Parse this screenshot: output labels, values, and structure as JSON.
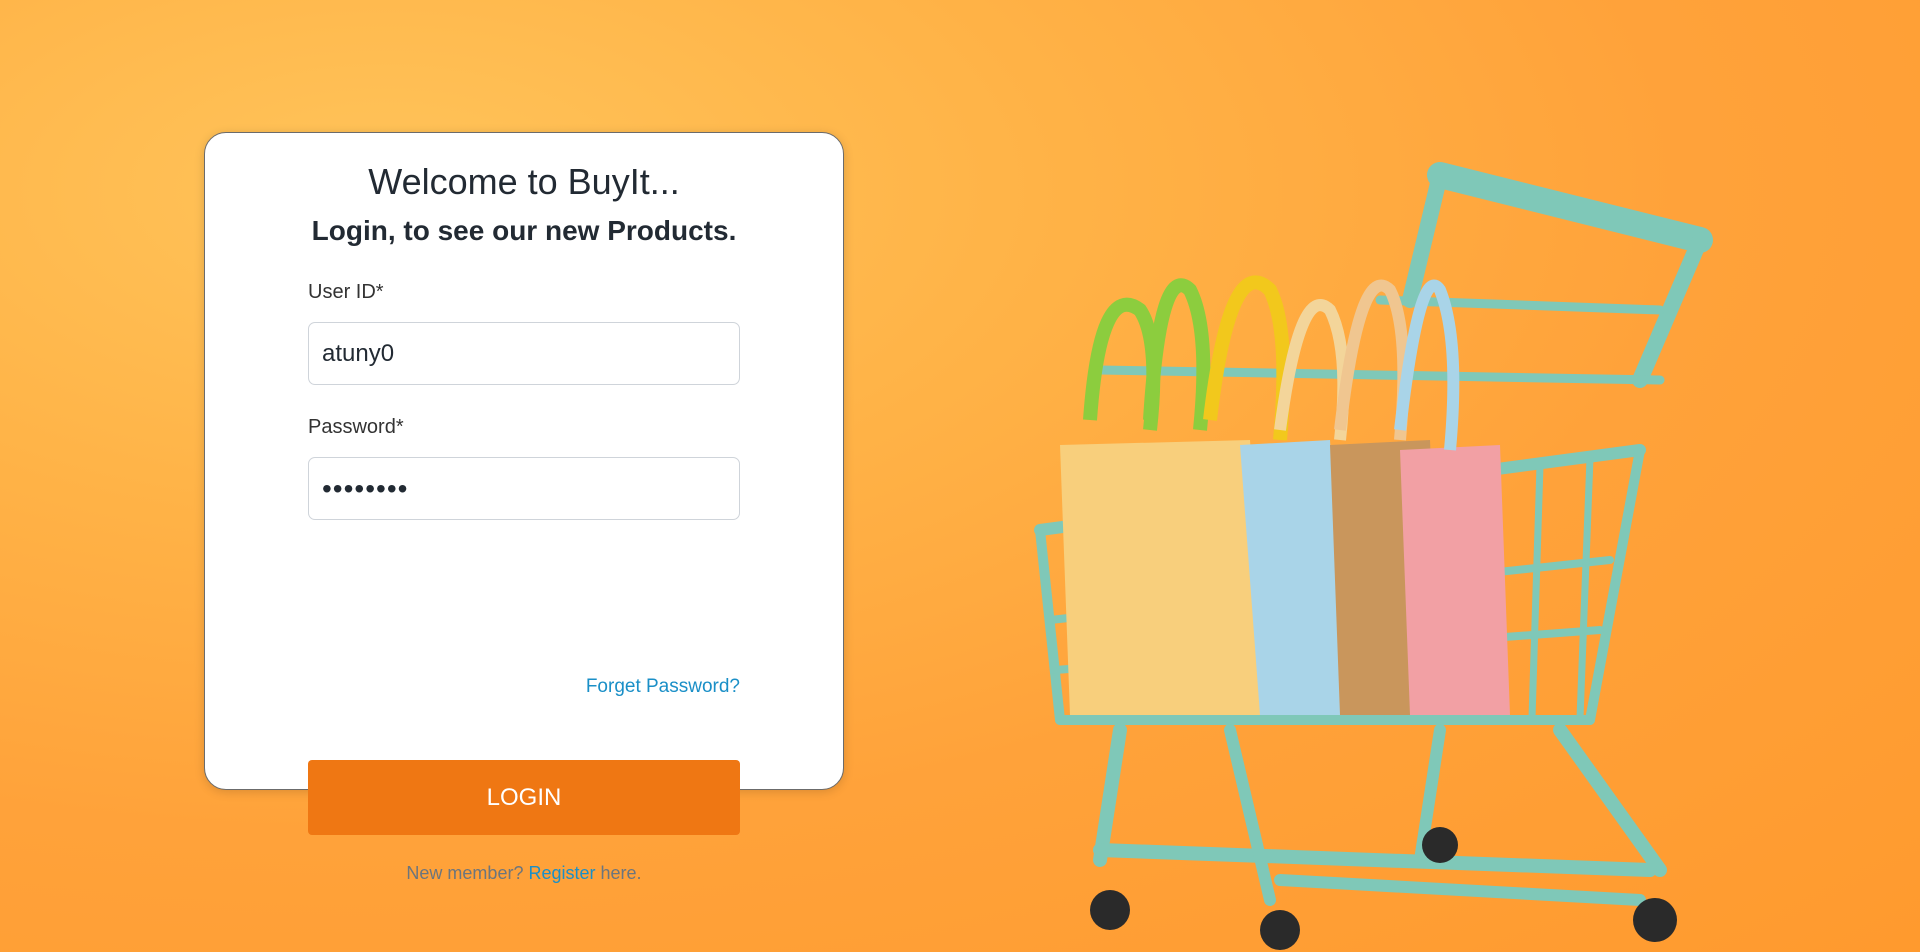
{
  "login_card": {
    "title": "Welcome to BuyIt...",
    "subtitle": "Login, to see our new Products.",
    "user_id": {
      "label": "User ID*",
      "value": "atuny0"
    },
    "password": {
      "label": "Password*",
      "value": "••••••••"
    },
    "forgot_password_label": "Forget Password?",
    "login_button_label": "LOGIN",
    "register": {
      "prefix": "New member?",
      "link_label": "Register",
      "suffix": "here."
    }
  },
  "colors": {
    "background": "#ffa63a",
    "primary_button": "#ef7713",
    "link": "#1a8fc7",
    "card": "#ffffff",
    "cart": "#7fc8b8"
  },
  "illustration": {
    "icon": "shopping-cart-with-bags-icon"
  }
}
